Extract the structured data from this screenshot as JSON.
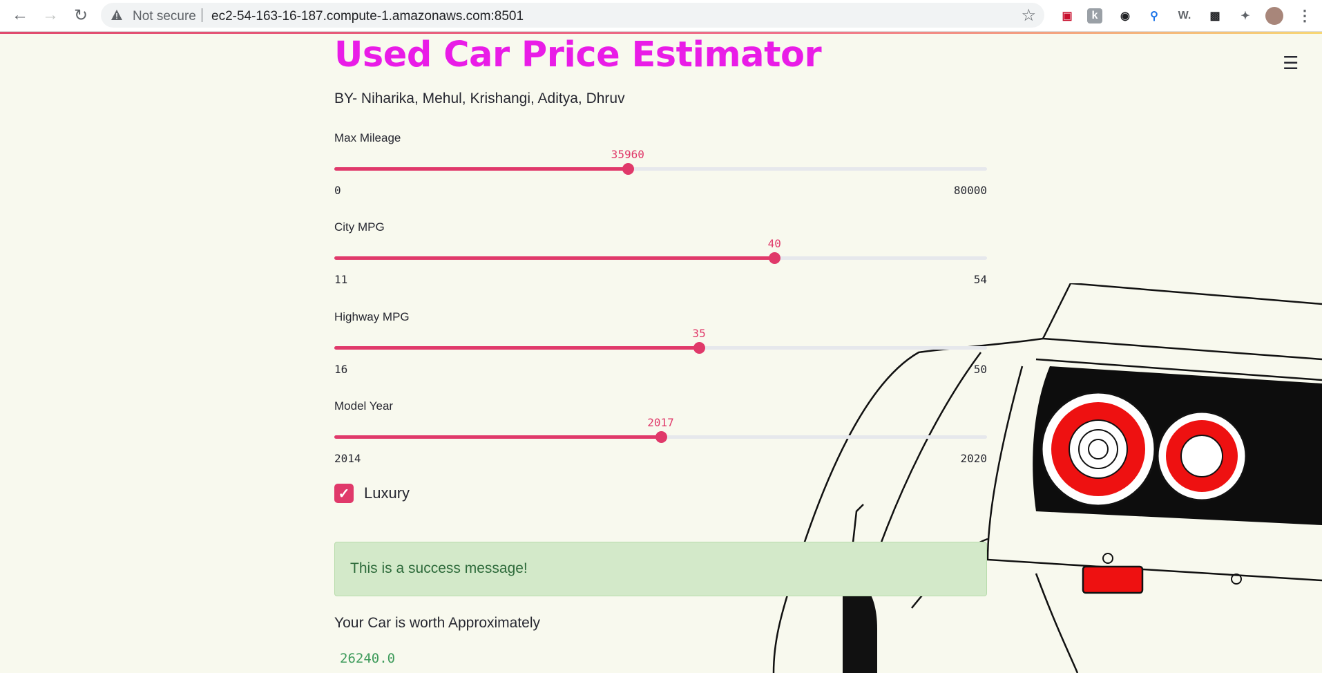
{
  "browser": {
    "security_label": "Not secure",
    "url": "ec2-54-163-16-187.compute-1.amazonaws.com:8501"
  },
  "app": {
    "title": "Used Car Price Estimator",
    "subtitle": "BY- Niharika, Mehul, Krishangi, Aditya, Dhruv",
    "sliders": [
      {
        "label": "Max Mileage",
        "value": "35960",
        "min": "0",
        "max": "80000",
        "fraction": 0.4495
      },
      {
        "label": "City MPG",
        "value": "40",
        "min": "11",
        "max": "54",
        "fraction": 0.6744
      },
      {
        "label": "Highway MPG",
        "value": "35",
        "min": "16",
        "max": "50",
        "fraction": 0.5588
      },
      {
        "label": "Model Year",
        "value": "2017",
        "min": "2014",
        "max": "2020",
        "fraction": 0.5
      }
    ],
    "checkbox": {
      "label": "Luxury",
      "checked": true
    },
    "success_message": "This is a success message!",
    "worth_label": "Your Car is worth Approximately",
    "price": "26240.0"
  },
  "colors": {
    "title": "#e91ce7",
    "accent": "#e0396a",
    "background": "#f8f9ee",
    "success_bg": "#d3e9c9",
    "price_text": "#3e9b5b"
  }
}
